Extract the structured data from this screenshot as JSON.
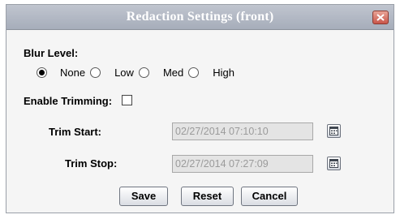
{
  "dialog": {
    "title": "Redaction Settings (front)",
    "close_icon": "close-icon"
  },
  "blur": {
    "label": "Blur Level:",
    "options": [
      {
        "label": "None",
        "checked": true
      },
      {
        "label": "Low",
        "checked": false
      },
      {
        "label": "Med",
        "checked": false
      },
      {
        "label": "High",
        "checked": false
      }
    ]
  },
  "trimming": {
    "label": "Enable Trimming:",
    "enabled": false
  },
  "trim_start": {
    "label": "Trim Start:",
    "value": "02/27/2014 07:10:10"
  },
  "trim_stop": {
    "label": "Trim Stop:",
    "value": "02/27/2014 07:27:09"
  },
  "buttons": {
    "save": "Save",
    "reset": "Reset",
    "cancel": "Cancel"
  },
  "colors": {
    "title_bar": "#a6adba",
    "close_button": "#c9564a",
    "dialog_background": "#f5f5f5",
    "disabled_field": "#e4e4e4"
  }
}
